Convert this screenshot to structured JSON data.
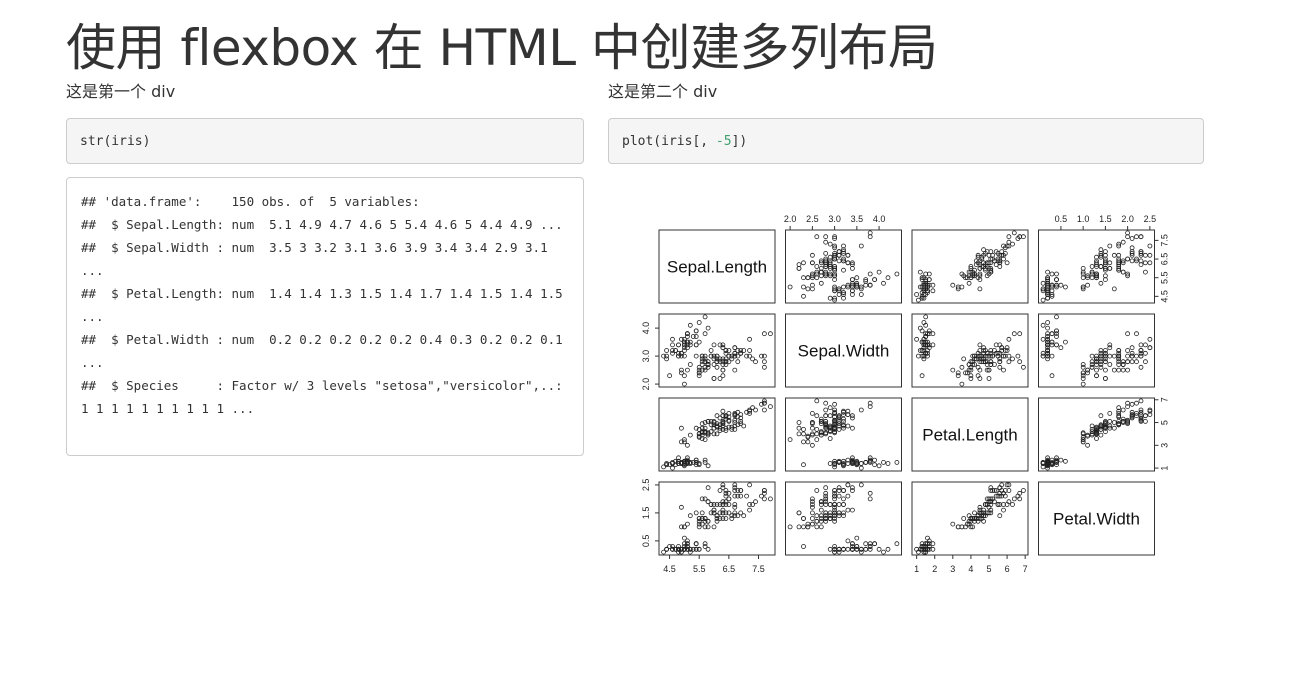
{
  "page_title": "使用 flexbox 在 HTML 中创建多列布局",
  "col1": {
    "label": "这是第一个 div",
    "code": "str(iris)",
    "output_lines": [
      "## 'data.frame':    150 obs. of  5 variables:",
      "##  $ Sepal.Length: num  5.1 4.9 4.7 4.6 5 5.4 4.6 5 4.4 4.9 ...",
      "##  $ Sepal.Width : num  3.5 3 3.2 3.1 3.6 3.9 3.4 3.4 2.9 3.1 ...",
      "##  $ Petal.Length: num  1.4 1.4 1.3 1.5 1.4 1.7 1.4 1.5 1.4 1.5 ...",
      "##  $ Petal.Width : num  0.2 0.2 0.2 0.2 0.2 0.4 0.3 0.2 0.2 0.1 ...",
      "##  $ Species     : Factor w/ 3 levels \"setosa\",\"versicolor\",..: 1 1 1 1 1 1 1 1 1 1 ..."
    ]
  },
  "col2": {
    "label": "这是第二个 div",
    "code_prefix": "plot(iris[, ",
    "code_number": "-5",
    "code_suffix": "])"
  },
  "chart_data": {
    "type": "scatter",
    "variables": [
      "Sepal.Length",
      "Sepal.Width",
      "Petal.Length",
      "Petal.Width"
    ],
    "axis_ticks": {
      "Sepal.Length": [
        "4.5",
        "5.5",
        "6.5",
        "7.5"
      ],
      "Sepal.Width": [
        "2.0",
        "2.5",
        "3.0",
        "3.5",
        "4.0"
      ],
      "Petal.Length": [
        "1",
        "2",
        "3",
        "4",
        "5",
        "6",
        "7"
      ],
      "Petal.Width": [
        "0.5",
        "1.0",
        "1.5",
        "2.0",
        "2.5"
      ]
    },
    "axis_ticks_left": {
      "Sepal.Width": [
        "2.0",
        "3.0",
        "4.0"
      ],
      "Petal.Width": [
        "0.5",
        "1.5",
        "2.5"
      ]
    },
    "axis_ticks_right": {
      "Sepal.Length": [
        "4.5",
        "5.5",
        "6.5",
        "7.5"
      ],
      "Petal.Length": [
        "1",
        "3",
        "5",
        "7"
      ]
    },
    "ranges": {
      "Sepal.Length": [
        4.3,
        7.9
      ],
      "Sepal.Width": [
        2.0,
        4.4
      ],
      "Petal.Length": [
        1.0,
        6.9
      ],
      "Petal.Width": [
        0.1,
        2.5
      ]
    },
    "sepal_length": [
      5.1,
      4.9,
      4.7,
      4.6,
      5.0,
      5.4,
      4.6,
      5.0,
      4.4,
      4.9,
      5.4,
      4.8,
      4.8,
      4.3,
      5.8,
      5.7,
      5.4,
      5.1,
      5.7,
      5.1,
      5.4,
      5.1,
      4.6,
      5.1,
      4.8,
      5.0,
      5.0,
      5.2,
      5.2,
      4.7,
      4.8,
      5.4,
      5.2,
      5.5,
      4.9,
      5.0,
      5.5,
      4.9,
      4.4,
      5.1,
      5.0,
      4.5,
      4.4,
      5.0,
      5.1,
      4.8,
      5.1,
      4.6,
      5.3,
      5.0,
      7.0,
      6.4,
      6.9,
      5.5,
      6.5,
      5.7,
      6.3,
      4.9,
      6.6,
      5.2,
      5.0,
      5.9,
      6.0,
      6.1,
      5.6,
      6.7,
      5.6,
      5.8,
      6.2,
      5.6,
      5.9,
      6.1,
      6.3,
      6.1,
      6.4,
      6.6,
      6.8,
      6.7,
      6.0,
      5.7,
      5.5,
      5.5,
      5.8,
      6.0,
      5.4,
      6.0,
      6.7,
      6.3,
      5.6,
      5.5,
      5.5,
      6.1,
      5.8,
      5.0,
      5.6,
      5.7,
      5.7,
      6.2,
      5.1,
      5.7,
      6.3,
      5.8,
      7.1,
      6.3,
      6.5,
      7.6,
      4.9,
      7.3,
      6.7,
      7.2,
      6.5,
      6.4,
      6.8,
      5.7,
      5.8,
      6.4,
      6.5,
      7.7,
      7.7,
      6.0,
      6.9,
      5.6,
      7.7,
      6.3,
      6.7,
      7.2,
      6.2,
      6.1,
      6.4,
      7.2,
      7.4,
      7.9,
      6.4,
      6.3,
      6.1,
      7.7,
      6.3,
      6.4,
      6.0,
      6.9,
      6.7,
      6.9,
      5.8,
      6.8,
      6.7,
      6.7,
      6.3,
      6.5,
      6.2,
      5.9
    ],
    "sepal_width": [
      3.5,
      3.0,
      3.2,
      3.1,
      3.6,
      3.9,
      3.4,
      3.4,
      2.9,
      3.1,
      3.7,
      3.4,
      3.0,
      3.0,
      4.0,
      4.4,
      3.9,
      3.5,
      3.8,
      3.8,
      3.4,
      3.7,
      3.6,
      3.3,
      3.4,
      3.0,
      3.4,
      3.5,
      3.4,
      3.2,
      3.1,
      3.4,
      4.1,
      4.2,
      3.1,
      3.2,
      3.5,
      3.6,
      3.0,
      3.4,
      3.5,
      2.3,
      3.2,
      3.5,
      3.8,
      3.0,
      3.8,
      3.2,
      3.7,
      3.3,
      3.2,
      3.2,
      3.1,
      2.3,
      2.8,
      2.8,
      3.3,
      2.4,
      2.9,
      2.7,
      2.0,
      3.0,
      2.2,
      2.9,
      2.9,
      3.1,
      3.0,
      2.7,
      2.2,
      2.5,
      3.2,
      2.8,
      2.5,
      2.8,
      2.9,
      3.0,
      2.8,
      3.0,
      2.9,
      2.6,
      2.4,
      2.4,
      2.7,
      2.7,
      3.0,
      3.4,
      3.1,
      2.3,
      3.0,
      2.5,
      2.6,
      3.0,
      2.6,
      2.3,
      2.7,
      3.0,
      2.9,
      2.9,
      2.5,
      2.8,
      3.3,
      2.7,
      3.0,
      2.9,
      3.0,
      3.0,
      2.5,
      2.9,
      2.5,
      3.6,
      3.2,
      2.7,
      3.0,
      2.5,
      2.8,
      3.2,
      3.0,
      3.8,
      2.6,
      2.2,
      3.2,
      2.8,
      2.8,
      2.7,
      3.3,
      3.2,
      2.8,
      3.0,
      2.8,
      3.0,
      2.8,
      3.8,
      2.8,
      2.8,
      2.6,
      3.0,
      3.4,
      3.1,
      3.0,
      3.1,
      3.1,
      3.1,
      2.7,
      3.2,
      3.3,
      3.0,
      2.5,
      3.0,
      3.4,
      3.0
    ],
    "petal_length": [
      1.4,
      1.4,
      1.3,
      1.5,
      1.4,
      1.7,
      1.4,
      1.5,
      1.4,
      1.5,
      1.5,
      1.6,
      1.4,
      1.1,
      1.2,
      1.5,
      1.3,
      1.4,
      1.7,
      1.5,
      1.7,
      1.5,
      1.0,
      1.7,
      1.9,
      1.6,
      1.6,
      1.5,
      1.4,
      1.6,
      1.6,
      1.5,
      1.5,
      1.4,
      1.5,
      1.2,
      1.3,
      1.4,
      1.3,
      1.5,
      1.3,
      1.3,
      1.3,
      1.6,
      1.9,
      1.4,
      1.6,
      1.4,
      1.5,
      1.4,
      4.7,
      4.5,
      4.9,
      4.0,
      4.6,
      4.5,
      4.7,
      3.3,
      4.6,
      3.9,
      3.5,
      4.2,
      4.0,
      4.7,
      3.6,
      4.4,
      4.5,
      4.1,
      4.5,
      3.9,
      4.8,
      4.0,
      4.9,
      4.7,
      4.3,
      4.4,
      4.8,
      5.0,
      4.5,
      3.5,
      3.8,
      3.7,
      3.9,
      5.1,
      4.5,
      4.5,
      4.7,
      4.4,
      4.1,
      4.0,
      4.4,
      4.6,
      4.0,
      3.3,
      4.2,
      4.2,
      4.2,
      4.3,
      3.0,
      4.1,
      6.0,
      5.1,
      5.9,
      5.6,
      5.8,
      6.6,
      4.5,
      6.3,
      5.8,
      6.1,
      5.1,
      5.3,
      5.5,
      5.0,
      5.1,
      5.3,
      5.5,
      6.7,
      6.9,
      5.0,
      5.7,
      4.9,
      6.7,
      4.9,
      5.7,
      6.0,
      4.8,
      4.9,
      5.6,
      5.8,
      6.1,
      6.4,
      5.6,
      5.1,
      5.6,
      6.1,
      5.6,
      5.5,
      4.8,
      5.4,
      5.6,
      5.1,
      5.1,
      5.9,
      5.7,
      5.2,
      5.0,
      5.2,
      5.4,
      5.1
    ],
    "petal_width": [
      0.2,
      0.2,
      0.2,
      0.2,
      0.2,
      0.4,
      0.3,
      0.2,
      0.2,
      0.1,
      0.2,
      0.2,
      0.1,
      0.1,
      0.2,
      0.4,
      0.4,
      0.3,
      0.3,
      0.3,
      0.2,
      0.4,
      0.2,
      0.5,
      0.2,
      0.2,
      0.4,
      0.2,
      0.2,
      0.2,
      0.2,
      0.4,
      0.1,
      0.2,
      0.2,
      0.2,
      0.2,
      0.1,
      0.2,
      0.2,
      0.3,
      0.3,
      0.2,
      0.6,
      0.4,
      0.3,
      0.2,
      0.2,
      0.2,
      0.2,
      1.4,
      1.5,
      1.5,
      1.3,
      1.5,
      1.3,
      1.6,
      1.0,
      1.3,
      1.4,
      1.0,
      1.5,
      1.0,
      1.4,
      1.3,
      1.4,
      1.5,
      1.0,
      1.5,
      1.1,
      1.8,
      1.3,
      1.5,
      1.2,
      1.3,
      1.4,
      1.4,
      1.7,
      1.5,
      1.0,
      1.1,
      1.0,
      1.2,
      1.6,
      1.5,
      1.6,
      1.5,
      1.3,
      1.3,
      1.3,
      1.2,
      1.4,
      1.2,
      1.0,
      1.3,
      1.2,
      1.3,
      1.3,
      1.1,
      1.3,
      2.5,
      1.9,
      2.1,
      1.8,
      2.2,
      2.1,
      1.7,
      1.8,
      1.8,
      2.5,
      2.0,
      1.9,
      2.1,
      2.0,
      2.4,
      2.3,
      1.8,
      2.2,
      2.3,
      1.5,
      2.3,
      2.0,
      2.0,
      1.8,
      2.1,
      1.8,
      1.8,
      1.8,
      2.1,
      1.6,
      1.9,
      2.0,
      2.2,
      1.5,
      1.4,
      2.3,
      2.4,
      1.8,
      1.8,
      2.1,
      2.4,
      2.3,
      1.9,
      2.3,
      2.5,
      2.3,
      1.9,
      2.0,
      2.3,
      1.8
    ]
  }
}
